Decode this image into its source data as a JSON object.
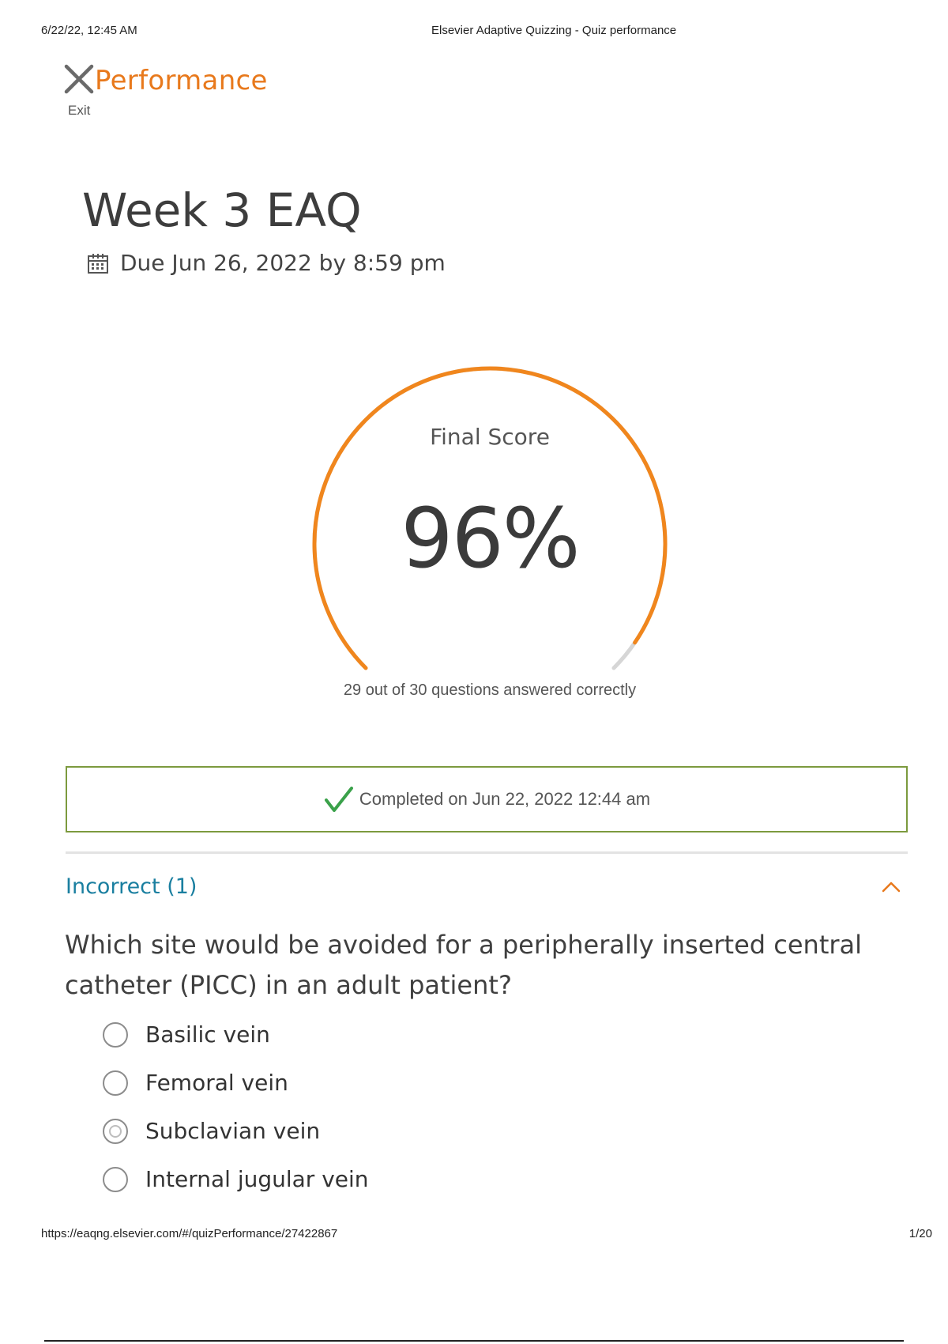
{
  "print_header": {
    "datetime": "6/22/22, 12:45 AM",
    "page_title": "Elsevier Adaptive Quizzing - Quiz performance"
  },
  "topbar": {
    "exit_label": "Exit",
    "title": "Performance",
    "accent_color": "#e8791c"
  },
  "quiz": {
    "title": "Week 3 EAQ",
    "due": "Due Jun 26, 2022 by 8:59 pm"
  },
  "score": {
    "label": "Final Score",
    "value_text": "96%",
    "fraction": 0.96,
    "summary": "29 out of 30 questions answered correctly",
    "progress_color": "#f0861d",
    "track_color": "#d6d6d6"
  },
  "completed": {
    "text": "Completed on Jun 22, 2022 12:44 am",
    "check_color": "#3aa14a",
    "border_color": "#7c9a3e"
  },
  "section": {
    "title": "Incorrect (1)",
    "title_color": "#1a7fa0",
    "expanded": true
  },
  "question": {
    "text": "Which site would be avoided for a peripherally inserted central catheter (PICC) in an adult patient?",
    "options": [
      {
        "label": "Basilic vein",
        "selected": false
      },
      {
        "label": "Femoral vein",
        "selected": false
      },
      {
        "label": "Subclavian vein",
        "selected": true
      },
      {
        "label": "Internal jugular vein",
        "selected": false
      }
    ]
  },
  "print_footer": {
    "url": "https://eaqng.elsevier.com/#/quizPerformance/27422867",
    "page_number": "1/20"
  }
}
